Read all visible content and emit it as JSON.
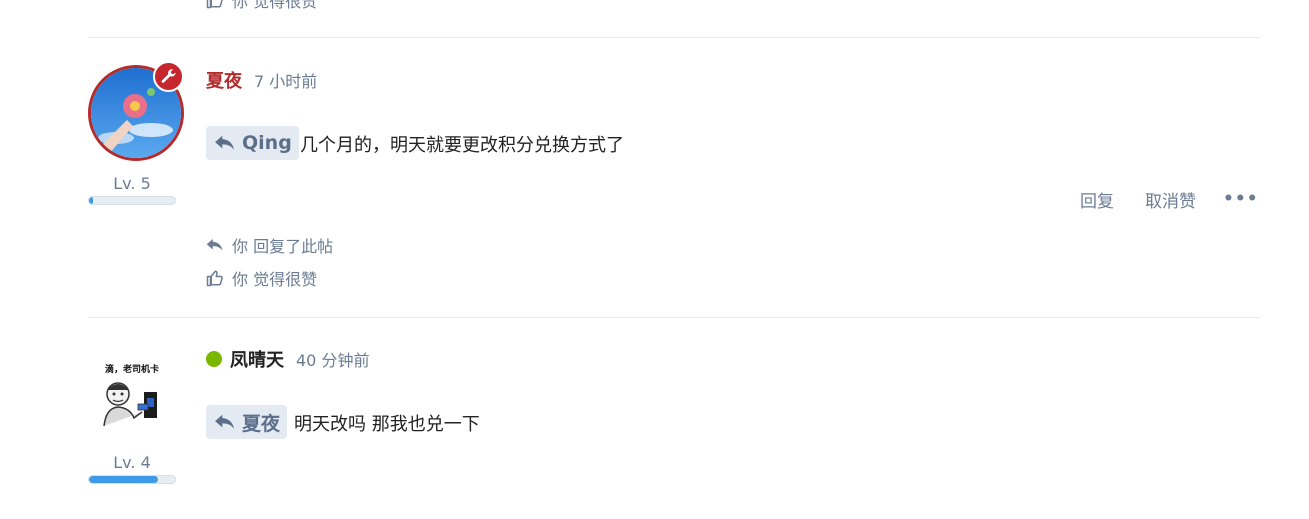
{
  "top_meta": {
    "like_text": "你 觉得很赞"
  },
  "posts": [
    {
      "username": "夏夜",
      "username_color": "#b32b2b",
      "time": "7 小时前",
      "level": "Lv. 5",
      "level_progress": 0.05,
      "reply_to": "Qing",
      "content": "几个月的，明天就要更改积分兑换方式了",
      "actions": {
        "reply": "回复",
        "unlike": "取消赞",
        "more": "•••"
      },
      "meta": {
        "replied": "你 回复了此帖",
        "liked": "你 觉得很赞"
      }
    },
    {
      "username": "凤晴天",
      "status_color": "#7ab800",
      "time": "40 分钟前",
      "level": "Lv. 4",
      "level_progress": 0.8,
      "reply_to": "夏夜",
      "content": "明天改吗 那我也兑一下",
      "avatar_caption": "滴，老司机卡"
    }
  ]
}
